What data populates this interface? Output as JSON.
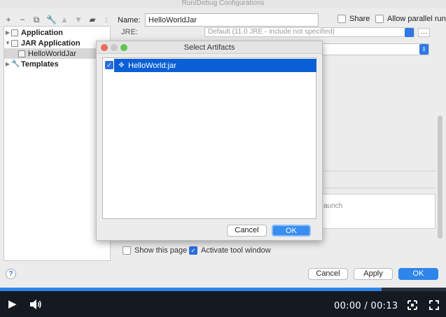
{
  "window": {
    "title": "Run/Debug Configurations"
  },
  "tree": {
    "items": [
      {
        "label": "Application",
        "bold": true,
        "level": 0
      },
      {
        "label": "JAR Application",
        "bold": true,
        "level": 0
      },
      {
        "label": "HelloWorldJar",
        "bold": false,
        "level": 1
      },
      {
        "label": "Templates",
        "bold": true,
        "level": 0
      }
    ]
  },
  "config": {
    "name_label": "Name:",
    "name_value": "HelloWorldJar",
    "share_label": "Share",
    "parallel_label": "Allow parallel run",
    "jre_label": "JRE:",
    "jre_value": "Default (11.0 JRE - include not specified)",
    "bg_text": "aunch",
    "show_page_label": "Show this page",
    "activate_label": "Activate tool window"
  },
  "dialog": {
    "title": "Select Artifacts",
    "artifact": "HelloWorld:jar",
    "cancel_label": "Cancel",
    "ok_label": "OK"
  },
  "footer": {
    "help_label": "?",
    "cancel_label": "Cancel",
    "apply_label": "Apply",
    "ok_label": "OK"
  },
  "video": {
    "time": "00:00 / 00:13",
    "progress": 0.855
  },
  "colors": {
    "accent": "#2f85ea",
    "selection": "#0b5fd6",
    "player_bg": "#151a22"
  }
}
